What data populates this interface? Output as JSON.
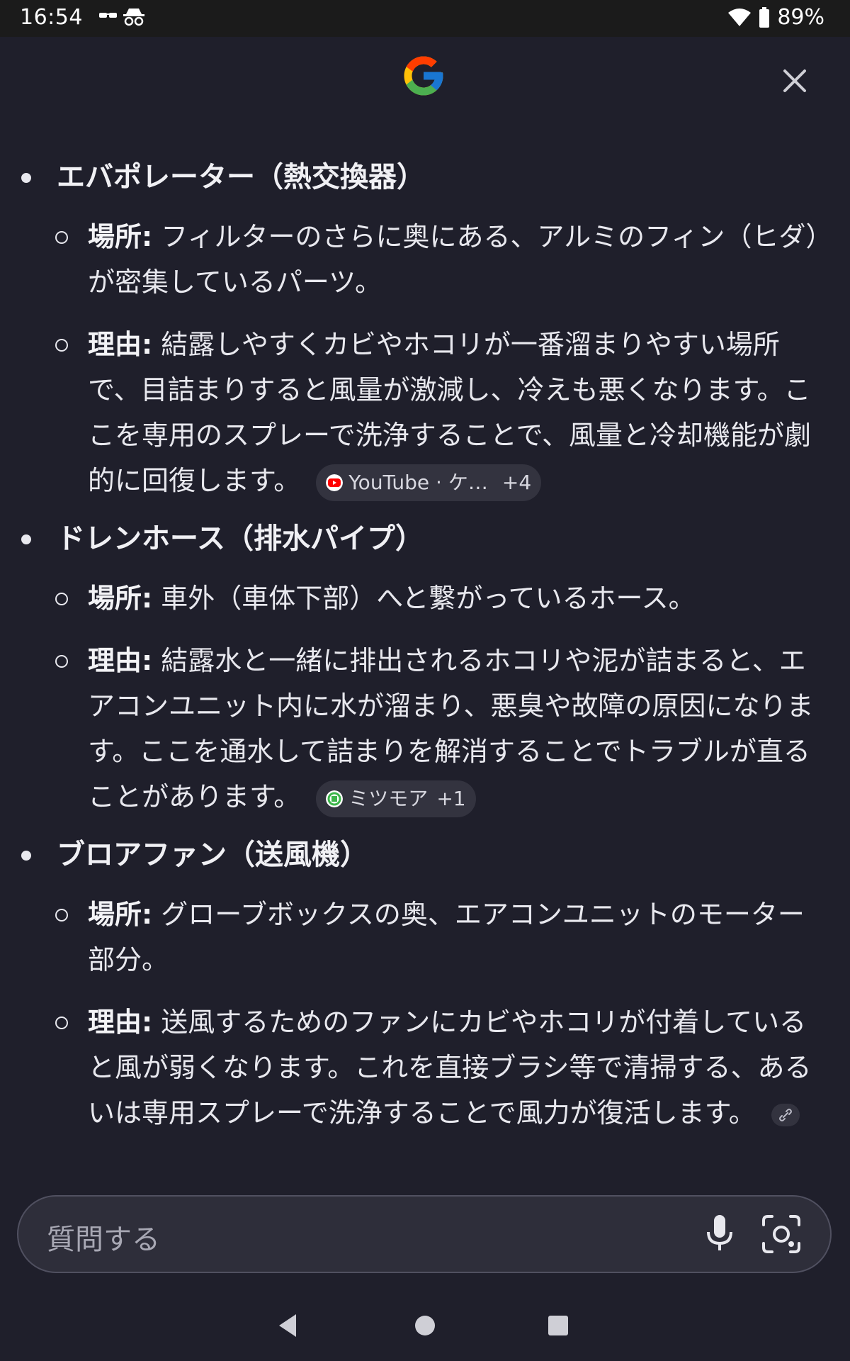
{
  "status_bar": {
    "time": "16:54",
    "battery": "89%"
  },
  "header": {
    "logo": "google-g-logo",
    "close_icon": "close-icon"
  },
  "sections": [
    {
      "title": "エバポレーター（熱交換器）",
      "location_label": "場所:",
      "location_text": " フィルターのさらに奥にある、アルミのフィン（ヒダ）が密集しているパーツ。",
      "reason_label": "理由:",
      "reason_text": " 結露しやすくカビやホコリが一番溜まりやすい場所で、目詰まりすると風量が激減し、冷えも悪くなります。ここを専用のスプレーで洗浄することで、風量と冷却機能が劇的に回復します。",
      "source_chip": {
        "icon": "youtube-icon",
        "label": "YouTube · ケ…",
        "more": "+4"
      }
    },
    {
      "title": "ドレンホース（排水パイプ）",
      "location_label": "場所:",
      "location_text": " 車外（車体下部）へと繋がっているホース。",
      "reason_label": "理由:",
      "reason_text": " 結露水と一緒に排出されるホコリや泥が詰まると、エアコンユニット内に水が溜まり、悪臭や故障の原因になります。ここを通水して詰まりを解消することでトラブルが直ることがあります。",
      "source_chip": {
        "icon": "mitsumore-icon",
        "label": "ミツモア",
        "more": "+1"
      }
    },
    {
      "title": "ブロアファン（送風機）",
      "location_label": "場所:",
      "location_text": " グローブボックスの奥、エアコンユニットのモーター部分。",
      "reason_label": "理由:",
      "reason_text": " 送風するためのファンにカビやホコリが付着していると風が弱くなります。これを直接ブラシ等で清掃する、あるいは専用スプレーで洗浄することで風力が復活します。",
      "source_chip": {
        "icon": "link-icon"
      }
    }
  ],
  "input": {
    "placeholder": "質問する",
    "mic_icon": "mic-icon",
    "lens_icon": "lens-icon"
  },
  "nav": {
    "back": "back-icon",
    "home": "home-icon",
    "recents": "recents-icon"
  }
}
